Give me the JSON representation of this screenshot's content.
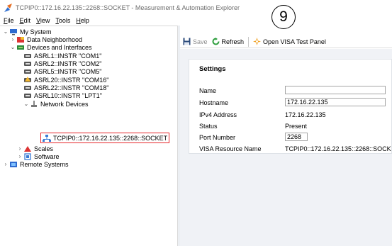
{
  "window": {
    "title": "TCPIP0::172.16.22.135::2268::SOCKET - Measurement & Automation Explorer"
  },
  "menu": [
    "File",
    "Edit",
    "View",
    "Tools",
    "Help"
  ],
  "tree": {
    "my_system": "My System",
    "data_neighborhood": "Data Neighborhood",
    "devices_and_interfaces": "Devices and Interfaces",
    "asrl1": "ASRL1::INSTR \"COM1\"",
    "asrl2": "ASRL2::INSTR \"COM2\"",
    "asrl5": "ASRL5::INSTR \"COM5\"",
    "asrl20": "ASRL20::INSTR \"COM16\"",
    "asrl22": "ASRL22::INSTR \"COM18\"",
    "asrl10": "ASRL10::INSTR \"LPT1\"",
    "network_devices": "Network Devices",
    "tcpip_socket": "TCPIP0::172.16.22.135::2268::SOCKET",
    "scales": "Scales",
    "software": "Software",
    "remote_systems": "Remote Systems"
  },
  "toolbar": {
    "save": "Save",
    "refresh": "Refresh",
    "open_visa": "Open VISA Test Panel"
  },
  "callout": "9",
  "settings": {
    "heading": "Settings",
    "name_label": "Name",
    "name_value": "",
    "hostname_label": "Hostname",
    "hostname_value": "172.16.22.135",
    "ipv4_label": "IPv4 Address",
    "ipv4_value": "172.16.22.135",
    "status_label": "Status",
    "status_value": "Present",
    "port_label": "Port Number",
    "port_value": "2268",
    "visa_label": "VISA Resource Name",
    "visa_value": "TCPIP0::172.16.22.135::2268::SOCK"
  },
  "colors": {
    "highlight_box": "#e5252a",
    "panel_bg": "#f0f2f6"
  }
}
